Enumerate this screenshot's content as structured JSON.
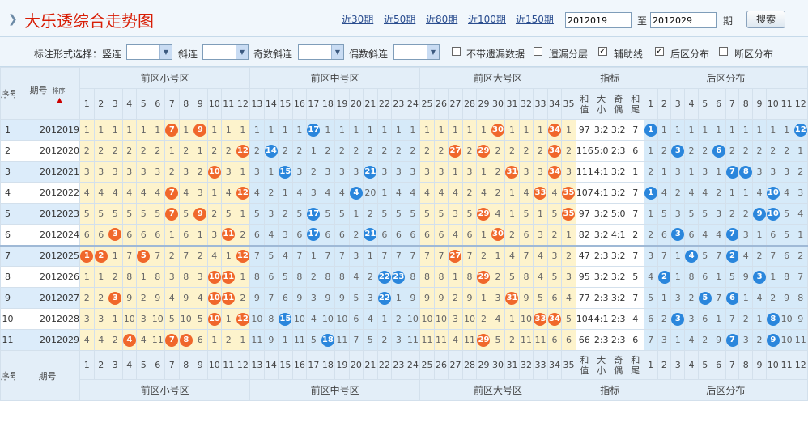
{
  "header": {
    "title": "大乐透综合走势图",
    "links": [
      "近30期",
      "近50期",
      "近80期",
      "近100期",
      "近150期"
    ],
    "from": "2012019",
    "to_label": "至",
    "to": "2012029",
    "period_label": "期",
    "search": "搜索"
  },
  "options": {
    "label": "标注形式选择：竖连",
    "slant": "斜连",
    "odd_slant": "奇数斜连",
    "even_slant": "偶数斜连",
    "cb1": "不带遗漏数据",
    "cb2": "遗漏分层",
    "cb3": "辅助线",
    "cb4": "后区分布",
    "cb5": "断区分布",
    "cb1_checked": false,
    "cb2_checked": false,
    "cb3_checked": true,
    "cb4_checked": true,
    "cb5_checked": false
  },
  "table": {
    "seq_header": "序号",
    "period_header": "期号",
    "sort_label": "排序",
    "sections": [
      "前区小号区",
      "前区中号区",
      "前区大号区",
      "指标",
      "后区分布"
    ],
    "stat_headers": [
      "和值",
      "大小",
      "奇偶",
      "和尾"
    ],
    "rows": [
      {
        "seq": "1",
        "period": "2012019",
        "front": "1 1 1 1 1 1 7 1 9 1 1 1 1 1 1 1 17 1 1 1 1 1 1 1 1 1 1 1 1 30 1 1 1 34 1",
        "stats": [
          "97",
          "3:2",
          "3:2",
          "7"
        ],
        "back": "1 1 1 1 1 1 1 1 1 1 1 12",
        "balls_front": [
          7,
          9,
          17,
          30,
          34
        ],
        "balls_back": [
          1,
          12
        ]
      },
      {
        "seq": "2",
        "period": "2012020",
        "front": "2 2 2 2 2 2 1 2 1 2 2 12 2 14 2 2 1 2 2 2 2 2 2 2 2 2 27 2 29 2 2 2 2 34 2",
        "stats": [
          "116",
          "5:0",
          "2:3",
          "6"
        ],
        "back": "1 2 3 2 2 6 2 2 2 2 2 1",
        "balls_front": [
          12,
          14,
          27,
          29,
          34
        ],
        "balls_back": [
          3,
          6
        ]
      },
      {
        "seq": "3",
        "period": "2012021",
        "front": "3 3 3 3 3 3 2 3 2 10 3 1 3 1 15 3 2 3 3 3 21 3 3 3 3 3 1 3 1 2 31 3 3 34 3",
        "stats": [
          "111",
          "4:1",
          "3:2",
          "1"
        ],
        "back": "2 1 3 1 3 1 7 8 3 3 3 2",
        "balls_front": [
          10,
          15,
          21,
          31,
          34
        ],
        "balls_back": [
          7,
          8
        ]
      },
      {
        "seq": "4",
        "period": "2012022",
        "front": "4 4 4 4 4 4 7 4 3 1 4 12 4 2 1 4 3 4 4 4 20 1 4 4 4 4 4 2 4 2 1 4 33 4 35",
        "stats": [
          "107",
          "4:1",
          "3:2",
          "7"
        ],
        "back": "1 4 2 4 4 2 1 1 4 10 4 3",
        "balls_front": [
          7,
          12,
          20,
          33,
          35
        ],
        "balls_back": [
          1,
          10
        ]
      },
      {
        "seq": "5",
        "period": "2012023",
        "front": "5 5 5 5 5 5 7 5 9 2 5 1 5 3 2 5 17 5 5 1 2 5 5 5 5 5 3 5 29 4 1 5 1 5 35",
        "stats": [
          "97",
          "3:2",
          "5:0",
          "7"
        ],
        "back": "1 5 3 5 5 3 2 2 9 10 5 4",
        "balls_front": [
          7,
          9,
          17,
          29,
          35
        ],
        "balls_back": [
          9,
          10
        ]
      },
      {
        "seq": "6",
        "period": "2012024",
        "front": "6 6 3 6 6 6 1 6 1 3 11 2 6 4 3 6 17 6 6 2 21 6 6 6 6 6 4 6 1 30 2 6 3 2 1",
        "stats": [
          "82",
          "3:2",
          "4:1",
          "2"
        ],
        "back": "2 6 3 6 4 4 7 3 1 6 5 1",
        "balls_front": [
          3,
          11,
          17,
          21,
          30
        ],
        "balls_back": [
          3,
          7
        ]
      },
      {
        "seq": "7",
        "period": "2012025",
        "front": "1 2 1 7 5 7 2 7 2 4 1 12 7 5 4 7 1 7 7 3 1 7 7 7 7 7 27 7 2 1 4 7 4 3 2",
        "stats": [
          "47",
          "2:3",
          "3:2",
          "7"
        ],
        "back": "3 7 1 4 5 7 2 4 2 7 6 2",
        "balls_front": [
          1,
          2,
          5,
          12,
          27
        ],
        "balls_back": [
          4,
          7
        ]
      },
      {
        "seq": "8",
        "period": "2012026",
        "front": "1 1 2 8 1 8 3 8 3 10 11 1 8 6 5 8 2 8 8 4 2 22 23 8 8 8 1 8 29 2 5 8 4 5 3",
        "stats": [
          "95",
          "3:2",
          "3:2",
          "5"
        ],
        "back": "4 2 1 8 6 1 5 9 3 1 8 7",
        "balls_front": [
          10,
          11,
          22,
          23,
          29
        ],
        "balls_back": [
          2,
          9
        ]
      },
      {
        "seq": "9",
        "period": "2012027",
        "front": "2 2 3 9 2 9 4 9 4 10 11 2 9 7 6 9 3 9 9 5 3 22 1 9 9 9 2 9 1 3 31 9 5 6 4",
        "stats": [
          "77",
          "2:3",
          "3:2",
          "7"
        ],
        "back": "5 1 3 2 5 7 6 1 4 2 9 8",
        "balls_front": [
          3,
          10,
          11,
          22,
          31
        ],
        "balls_back": [
          5,
          7
        ]
      },
      {
        "seq": "10",
        "period": "2012028",
        "front": "3 3 1 10 3 10 5 10 5 10 1 12 10 8 15 10 4 10 10 6 4 1 2 10 10 10 3 10 2 4 1 10 33 34 5",
        "stats": [
          "104",
          "4:1",
          "2:3",
          "4"
        ],
        "back": "6 2 3 3 6 1 7 2 1 8 10 9",
        "balls_front": [
          10,
          12,
          15,
          33,
          34
        ],
        "balls_back": [
          3,
          10
        ]
      },
      {
        "seq": "11",
        "period": "2012029",
        "front": "4 4 2 4 4 11 7 8 6 1 2 1 11 9 1 11 5 18 11 7 5 2 3 11 11 11 4 11 29 5 2 11 11 6 6",
        "stats": [
          "66",
          "2:3",
          "2:3",
          "6"
        ],
        "back": "7 3 1 4 2 9 7 3 2 9 10 11",
        "balls_front": [
          4,
          7,
          8,
          18,
          29
        ],
        "balls_back": [
          7,
          10
        ]
      }
    ],
    "footer_seq": "序号",
    "footer_period": "期号"
  }
}
